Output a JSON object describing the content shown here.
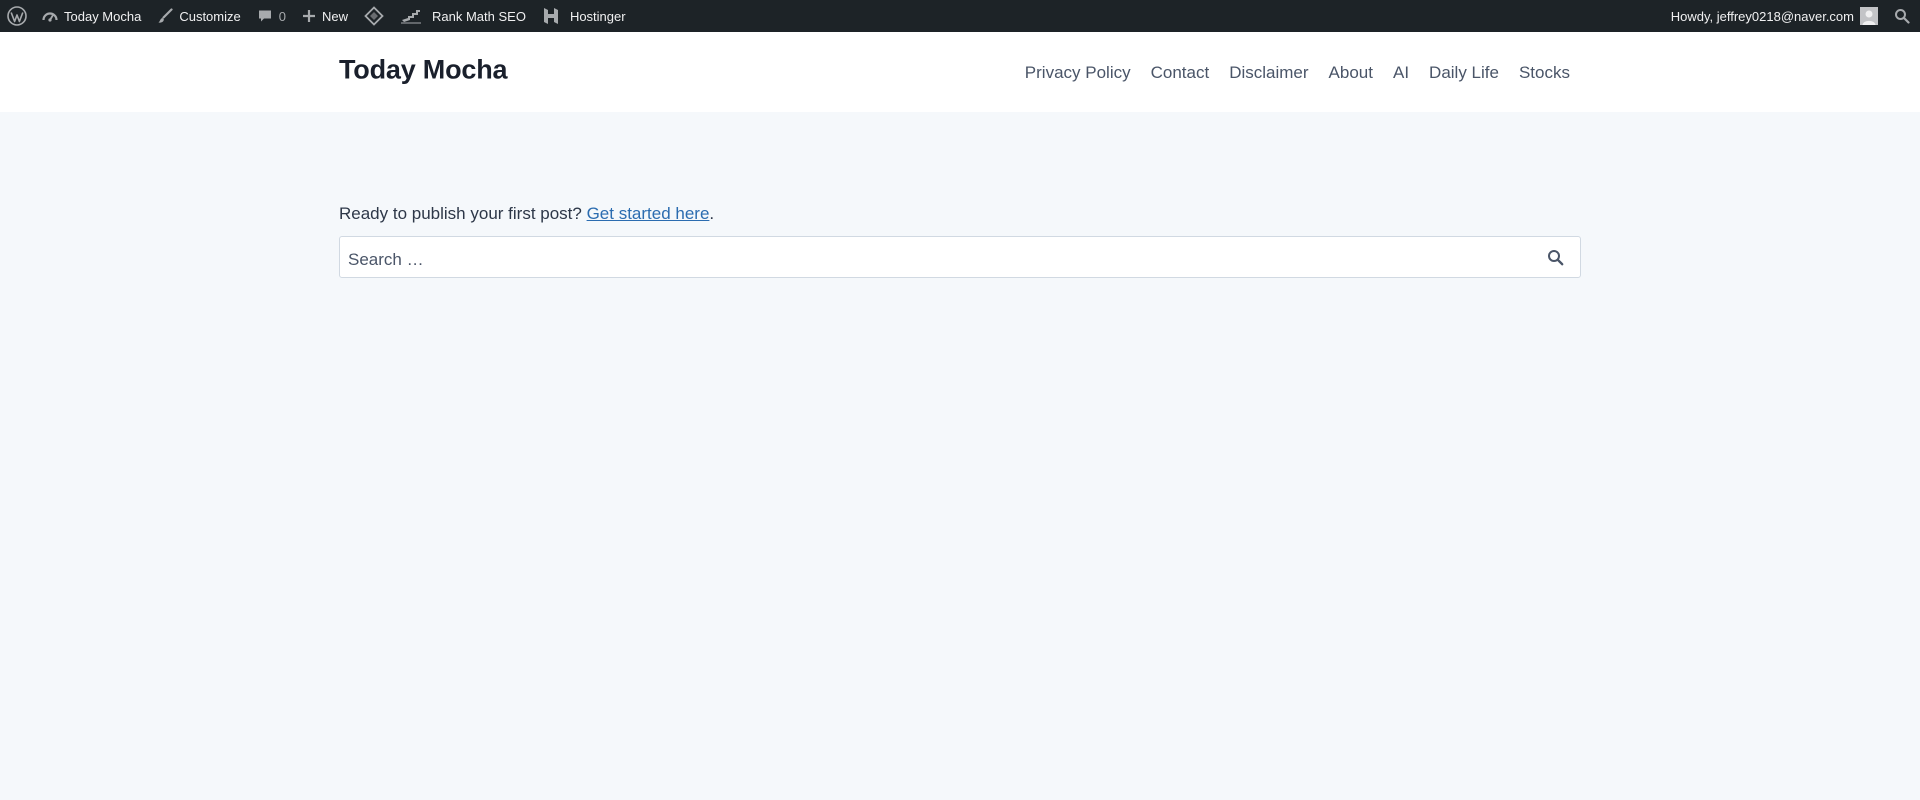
{
  "admin_bar": {
    "site_name": "Today Mocha",
    "customize": "Customize",
    "comments_count": "0",
    "new_label": "New",
    "rank_math": "Rank Math SEO",
    "hostinger": "Hostinger",
    "howdy": "Howdy, jeffrey0218@naver.com"
  },
  "header": {
    "site_title": "Today Mocha",
    "nav": [
      "Privacy Policy",
      "Contact",
      "Disclaimer",
      "About",
      "AI",
      "Daily Life",
      "Stocks"
    ]
  },
  "main": {
    "notice_text": "Ready to publish your first post? ",
    "notice_link": "Get started here",
    "notice_end": ".",
    "search_placeholder": "Search …"
  },
  "colors": {
    "admin_bar_bg": "#1d2327",
    "page_bg": "#f5f8fb",
    "link": "#2b6cb0",
    "title": "#1a202c"
  }
}
